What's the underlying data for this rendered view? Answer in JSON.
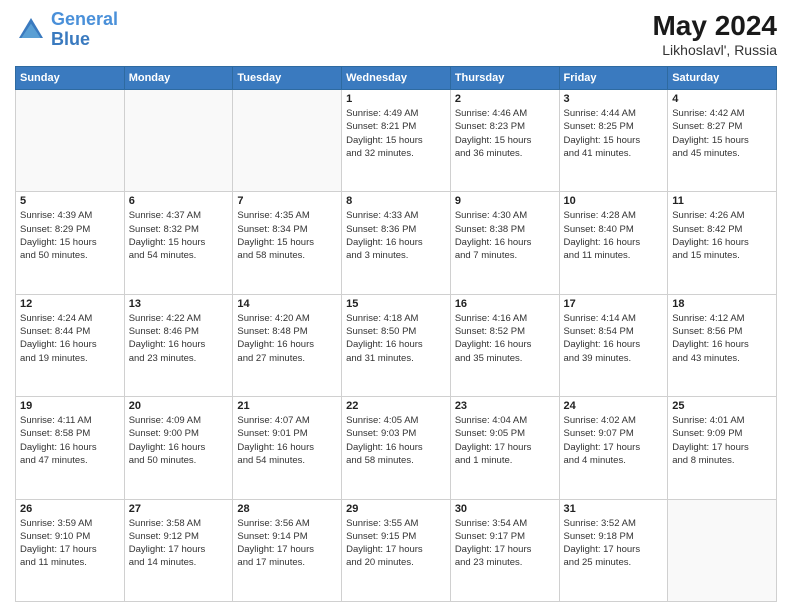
{
  "header": {
    "logo_line1": "General",
    "logo_line2": "Blue",
    "month_title": "May 2024",
    "location": "Likhoslavl', Russia"
  },
  "weekdays": [
    "Sunday",
    "Monday",
    "Tuesday",
    "Wednesday",
    "Thursday",
    "Friday",
    "Saturday"
  ],
  "rows": [
    [
      {
        "day": "",
        "info": ""
      },
      {
        "day": "",
        "info": ""
      },
      {
        "day": "",
        "info": ""
      },
      {
        "day": "1",
        "info": "Sunrise: 4:49 AM\nSunset: 8:21 PM\nDaylight: 15 hours\nand 32 minutes."
      },
      {
        "day": "2",
        "info": "Sunrise: 4:46 AM\nSunset: 8:23 PM\nDaylight: 15 hours\nand 36 minutes."
      },
      {
        "day": "3",
        "info": "Sunrise: 4:44 AM\nSunset: 8:25 PM\nDaylight: 15 hours\nand 41 minutes."
      },
      {
        "day": "4",
        "info": "Sunrise: 4:42 AM\nSunset: 8:27 PM\nDaylight: 15 hours\nand 45 minutes."
      }
    ],
    [
      {
        "day": "5",
        "info": "Sunrise: 4:39 AM\nSunset: 8:29 PM\nDaylight: 15 hours\nand 50 minutes."
      },
      {
        "day": "6",
        "info": "Sunrise: 4:37 AM\nSunset: 8:32 PM\nDaylight: 15 hours\nand 54 minutes."
      },
      {
        "day": "7",
        "info": "Sunrise: 4:35 AM\nSunset: 8:34 PM\nDaylight: 15 hours\nand 58 minutes."
      },
      {
        "day": "8",
        "info": "Sunrise: 4:33 AM\nSunset: 8:36 PM\nDaylight: 16 hours\nand 3 minutes."
      },
      {
        "day": "9",
        "info": "Sunrise: 4:30 AM\nSunset: 8:38 PM\nDaylight: 16 hours\nand 7 minutes."
      },
      {
        "day": "10",
        "info": "Sunrise: 4:28 AM\nSunset: 8:40 PM\nDaylight: 16 hours\nand 11 minutes."
      },
      {
        "day": "11",
        "info": "Sunrise: 4:26 AM\nSunset: 8:42 PM\nDaylight: 16 hours\nand 15 minutes."
      }
    ],
    [
      {
        "day": "12",
        "info": "Sunrise: 4:24 AM\nSunset: 8:44 PM\nDaylight: 16 hours\nand 19 minutes."
      },
      {
        "day": "13",
        "info": "Sunrise: 4:22 AM\nSunset: 8:46 PM\nDaylight: 16 hours\nand 23 minutes."
      },
      {
        "day": "14",
        "info": "Sunrise: 4:20 AM\nSunset: 8:48 PM\nDaylight: 16 hours\nand 27 minutes."
      },
      {
        "day": "15",
        "info": "Sunrise: 4:18 AM\nSunset: 8:50 PM\nDaylight: 16 hours\nand 31 minutes."
      },
      {
        "day": "16",
        "info": "Sunrise: 4:16 AM\nSunset: 8:52 PM\nDaylight: 16 hours\nand 35 minutes."
      },
      {
        "day": "17",
        "info": "Sunrise: 4:14 AM\nSunset: 8:54 PM\nDaylight: 16 hours\nand 39 minutes."
      },
      {
        "day": "18",
        "info": "Sunrise: 4:12 AM\nSunset: 8:56 PM\nDaylight: 16 hours\nand 43 minutes."
      }
    ],
    [
      {
        "day": "19",
        "info": "Sunrise: 4:11 AM\nSunset: 8:58 PM\nDaylight: 16 hours\nand 47 minutes."
      },
      {
        "day": "20",
        "info": "Sunrise: 4:09 AM\nSunset: 9:00 PM\nDaylight: 16 hours\nand 50 minutes."
      },
      {
        "day": "21",
        "info": "Sunrise: 4:07 AM\nSunset: 9:01 PM\nDaylight: 16 hours\nand 54 minutes."
      },
      {
        "day": "22",
        "info": "Sunrise: 4:05 AM\nSunset: 9:03 PM\nDaylight: 16 hours\nand 58 minutes."
      },
      {
        "day": "23",
        "info": "Sunrise: 4:04 AM\nSunset: 9:05 PM\nDaylight: 17 hours\nand 1 minute."
      },
      {
        "day": "24",
        "info": "Sunrise: 4:02 AM\nSunset: 9:07 PM\nDaylight: 17 hours\nand 4 minutes."
      },
      {
        "day": "25",
        "info": "Sunrise: 4:01 AM\nSunset: 9:09 PM\nDaylight: 17 hours\nand 8 minutes."
      }
    ],
    [
      {
        "day": "26",
        "info": "Sunrise: 3:59 AM\nSunset: 9:10 PM\nDaylight: 17 hours\nand 11 minutes."
      },
      {
        "day": "27",
        "info": "Sunrise: 3:58 AM\nSunset: 9:12 PM\nDaylight: 17 hours\nand 14 minutes."
      },
      {
        "day": "28",
        "info": "Sunrise: 3:56 AM\nSunset: 9:14 PM\nDaylight: 17 hours\nand 17 minutes."
      },
      {
        "day": "29",
        "info": "Sunrise: 3:55 AM\nSunset: 9:15 PM\nDaylight: 17 hours\nand 20 minutes."
      },
      {
        "day": "30",
        "info": "Sunrise: 3:54 AM\nSunset: 9:17 PM\nDaylight: 17 hours\nand 23 minutes."
      },
      {
        "day": "31",
        "info": "Sunrise: 3:52 AM\nSunset: 9:18 PM\nDaylight: 17 hours\nand 25 minutes."
      },
      {
        "day": "",
        "info": ""
      }
    ]
  ]
}
